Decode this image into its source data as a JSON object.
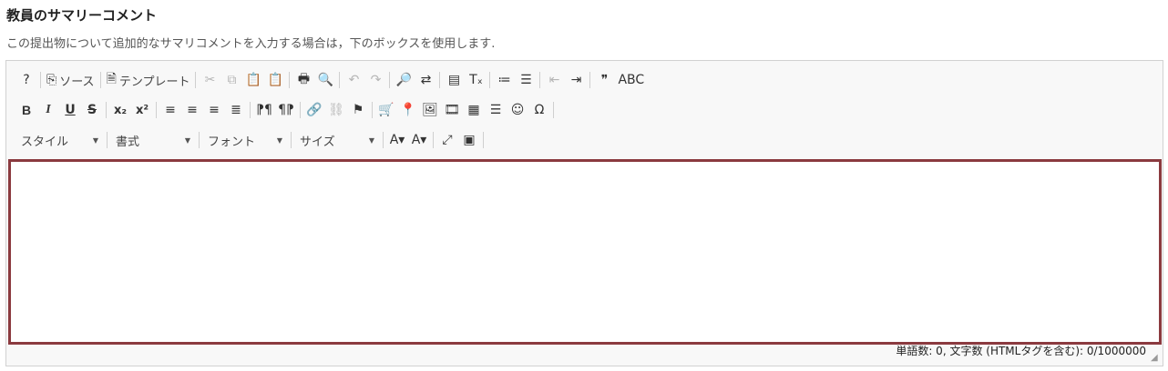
{
  "header": {
    "title": "教員のサマリーコメント",
    "description": "この提出物について追加的なサマリコメントを入力する場合は，下のボックスを使用します."
  },
  "toolbar": {
    "row1": [
      {
        "name": "help-button",
        "icon": "?",
        "state": "enabled"
      },
      {
        "name": "source-button",
        "icon": "⎘",
        "label": "ソース",
        "state": "enabled"
      },
      {
        "name": "template-button",
        "icon": "🗎",
        "label": "テンプレート",
        "state": "enabled"
      },
      {
        "name": "cut-button",
        "icon": "✂",
        "state": "disabled"
      },
      {
        "name": "copy-button",
        "icon": "⧉",
        "state": "disabled"
      },
      {
        "name": "paste-button",
        "icon": "📋",
        "state": "enabled"
      },
      {
        "name": "paste-text-button",
        "icon": "📋",
        "state": "enabled"
      },
      {
        "name": "print-button",
        "icon": "🖶",
        "state": "enabled"
      },
      {
        "name": "preview-button",
        "icon": "🔍",
        "state": "enabled"
      },
      {
        "name": "undo-button",
        "icon": "↶",
        "state": "disabled"
      },
      {
        "name": "redo-button",
        "icon": "↷",
        "state": "disabled"
      },
      {
        "name": "find-button",
        "icon": "🔎",
        "state": "enabled"
      },
      {
        "name": "replace-button",
        "icon": "⇄",
        "state": "enabled"
      },
      {
        "name": "select-all-button",
        "icon": "▤",
        "state": "enabled"
      },
      {
        "name": "remove-format-button",
        "icon": "Tₓ",
        "state": "enabled"
      },
      {
        "name": "numbered-list-button",
        "icon": "≔",
        "state": "enabled"
      },
      {
        "name": "bulleted-list-button",
        "icon": "☰",
        "state": "enabled"
      },
      {
        "name": "outdent-button",
        "icon": "⇤",
        "state": "disabled"
      },
      {
        "name": "indent-button",
        "icon": "⇥",
        "state": "enabled"
      },
      {
        "name": "blockquote-button",
        "icon": "❞",
        "state": "enabled"
      },
      {
        "name": "spellcheck-button",
        "icon": "ABC",
        "state": "enabled"
      }
    ],
    "row2": [
      {
        "name": "bold-button",
        "icon": "B",
        "state": "enabled"
      },
      {
        "name": "italic-button",
        "icon": "I",
        "state": "enabled"
      },
      {
        "name": "underline-button",
        "icon": "U",
        "state": "enabled"
      },
      {
        "name": "strike-button",
        "icon": "S",
        "state": "enabled"
      },
      {
        "name": "subscript-button",
        "icon": "x₂",
        "state": "enabled"
      },
      {
        "name": "superscript-button",
        "icon": "x²",
        "state": "enabled"
      },
      {
        "name": "align-left-button",
        "icon": "≡",
        "state": "enabled"
      },
      {
        "name": "align-center-button",
        "icon": "≡",
        "state": "enabled"
      },
      {
        "name": "align-right-button",
        "icon": "≡",
        "state": "enabled"
      },
      {
        "name": "justify-button",
        "icon": "≣",
        "state": "enabled"
      },
      {
        "name": "ltr-button",
        "icon": "⁋¶",
        "state": "enabled"
      },
      {
        "name": "rtl-button",
        "icon": "¶⁋",
        "state": "enabled"
      },
      {
        "name": "link-button",
        "icon": "🔗",
        "state": "enabled"
      },
      {
        "name": "unlink-button",
        "icon": "⛓",
        "state": "disabled"
      },
      {
        "name": "anchor-button",
        "icon": "⚑",
        "state": "enabled"
      },
      {
        "name": "cart-button",
        "icon": "🛒",
        "state": "enabled"
      },
      {
        "name": "pin-button",
        "icon": "📍",
        "state": "enabled"
      },
      {
        "name": "image-button",
        "icon": "🖼",
        "state": "enabled"
      },
      {
        "name": "video-button",
        "icon": "🎞",
        "state": "enabled"
      },
      {
        "name": "table-button",
        "icon": "▦",
        "state": "enabled"
      },
      {
        "name": "horizontal-line-button",
        "icon": "☰",
        "state": "enabled"
      },
      {
        "name": "smiley-button",
        "icon": "☺",
        "state": "enabled"
      },
      {
        "name": "special-char-button",
        "icon": "Ω",
        "state": "enabled"
      }
    ],
    "row3_combos": [
      {
        "name": "style-combo",
        "label": "スタイル"
      },
      {
        "name": "format-combo",
        "label": "書式"
      },
      {
        "name": "font-combo",
        "label": "フォント"
      },
      {
        "name": "size-combo",
        "label": "サイズ"
      }
    ],
    "row3_buttons": [
      {
        "name": "text-color-button",
        "icon": "A▾",
        "state": "enabled"
      },
      {
        "name": "bg-color-button",
        "icon": "A▾",
        "state": "enabled"
      },
      {
        "name": "maximize-button",
        "icon": "⤢",
        "state": "enabled"
      },
      {
        "name": "show-blocks-button",
        "icon": "▣",
        "state": "enabled"
      }
    ]
  },
  "editor": {
    "content": ""
  },
  "status": {
    "word_count": "単語数: 0, 文字数 (HTMLタグを含む): 0/1000000"
  },
  "colors": {
    "focus_border": "#8b3a3f",
    "toolbar_bg": "#f8f8f8",
    "disabled": "#b5b5b5"
  }
}
